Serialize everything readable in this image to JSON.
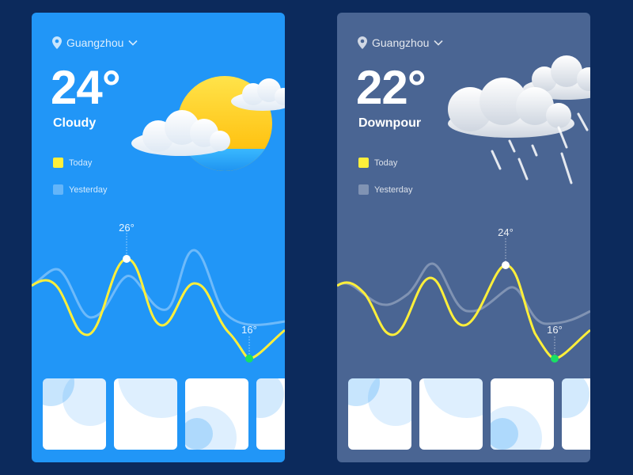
{
  "cards": [
    {
      "location": "Guangzhou",
      "temp": "24°",
      "condition": "Cloudy",
      "legend": {
        "today": "Today",
        "yesterday": "Yesterday"
      },
      "chart": {
        "high_label": "26°",
        "low_label": "16°"
      },
      "icon": "sun-behind-cloud"
    },
    {
      "location": "Guangzhou",
      "temp": "22°",
      "condition": "Downpour",
      "legend": {
        "today": "Today",
        "yesterday": "Yesterday"
      },
      "chart": {
        "high_label": "24°",
        "low_label": "16°"
      },
      "icon": "rain-cloud"
    }
  ],
  "colors": {
    "page_bg": "#0c2a5c",
    "card_sunny": "#2196f7",
    "card_rainy": "#4a6593",
    "today_line": "#ffef3a",
    "low_dot": "#19e064"
  }
}
